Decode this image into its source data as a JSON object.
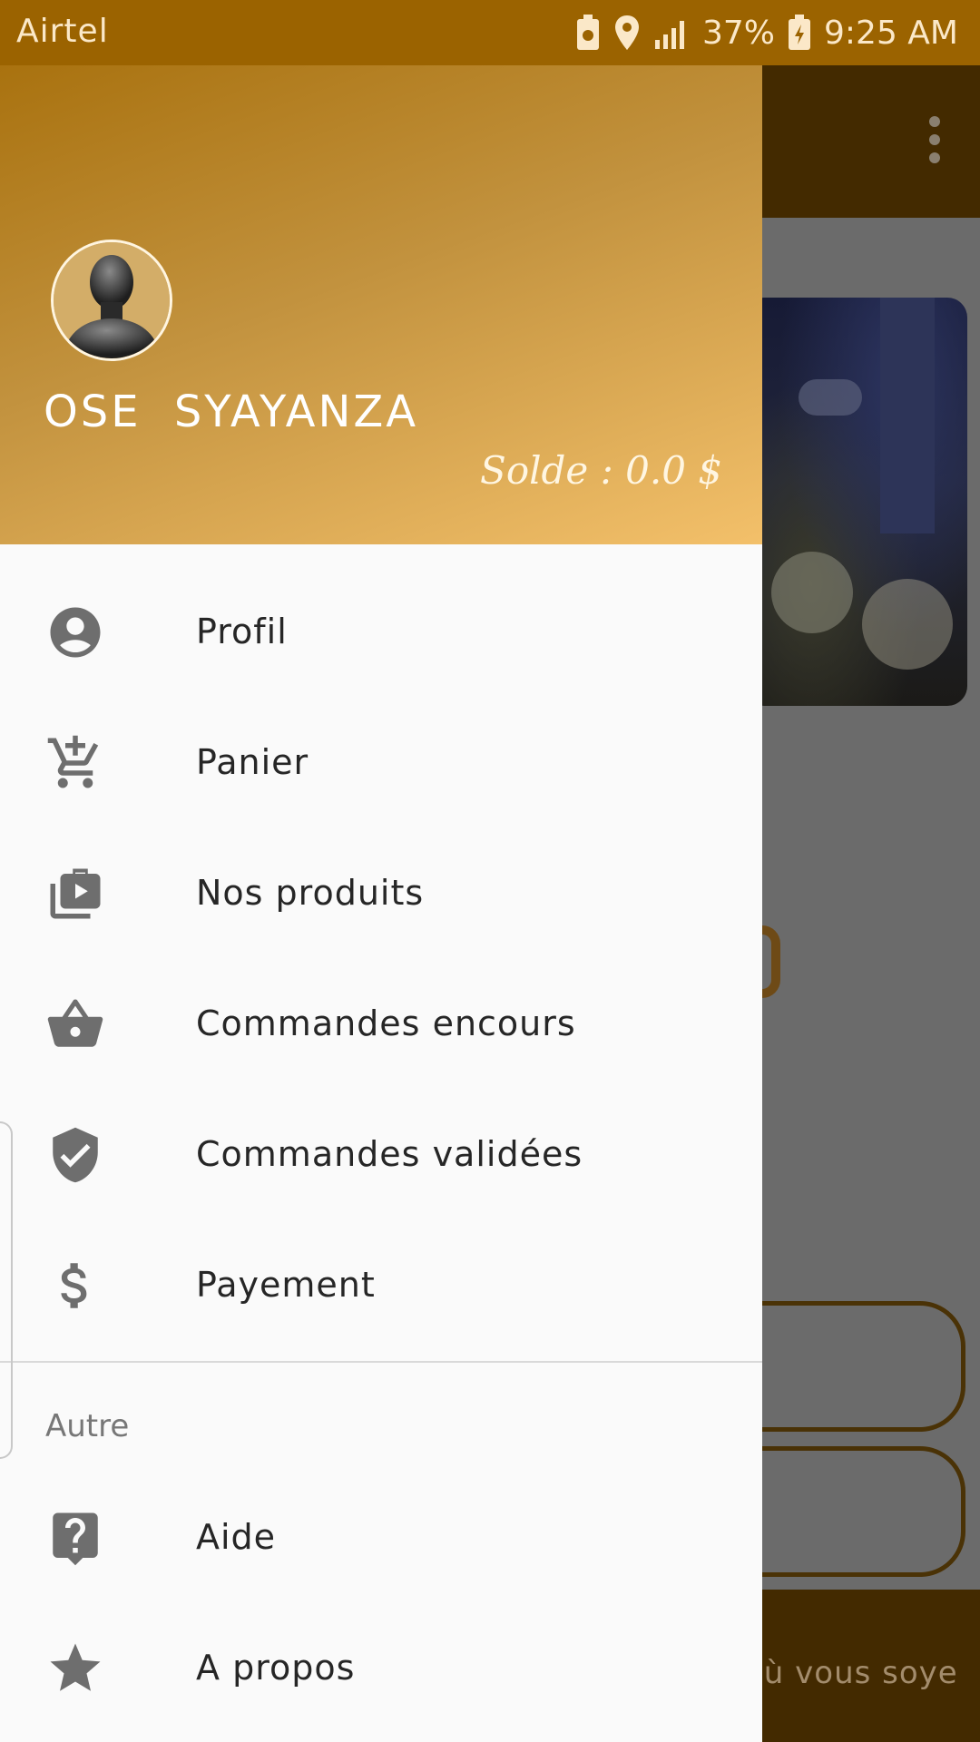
{
  "status_bar": {
    "carrier": "Airtel",
    "battery": "37%",
    "time": "9:25 AM",
    "icons": [
      "battery-saver-icon",
      "location-icon",
      "signal-icon",
      "battery-charging-icon"
    ]
  },
  "background_app": {
    "footer_text": "où vous soye"
  },
  "drawer": {
    "header": {
      "user_name": "OSE  SYAYANZA",
      "balance": "Solde : 0.0 $"
    },
    "items": [
      {
        "label": "Profil",
        "icon": "account-circle-icon"
      },
      {
        "label": "Panier",
        "icon": "add-shopping-cart-icon"
      },
      {
        "label": "Nos produits",
        "icon": "video-library-icon"
      },
      {
        "label": "Commandes encours",
        "icon": "shopping-basket-icon"
      },
      {
        "label": "Commandes validées",
        "icon": "verified-shield-icon"
      },
      {
        "label": "Payement",
        "icon": "dollar-icon"
      }
    ],
    "section_title": "Autre",
    "other_items": [
      {
        "label": "Aide",
        "icon": "help-icon"
      },
      {
        "label": "A propos",
        "icon": "star-icon"
      }
    ]
  },
  "colors": {
    "status_bar": "#9b6300",
    "header_gradient_start": "#a9720f",
    "header_gradient_end": "#f3c06a",
    "icon_gray": "#6e6e6e"
  }
}
